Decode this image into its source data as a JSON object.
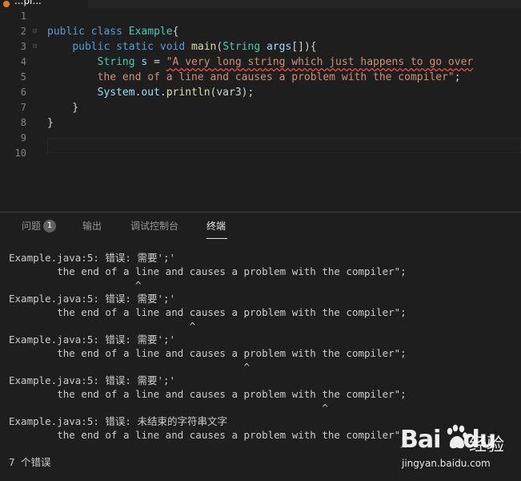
{
  "tab": {
    "label": "...pl..."
  },
  "editor": {
    "lines": [
      {
        "n": "1",
        "tokens": []
      },
      {
        "n": "2",
        "tokens": [
          {
            "t": "public",
            "c": "kw"
          },
          {
            "t": " ",
            "c": "pl"
          },
          {
            "t": "class",
            "c": "kw"
          },
          {
            "t": " ",
            "c": "pl"
          },
          {
            "t": "Example",
            "c": "ty"
          },
          {
            "t": "{",
            "c": "pl"
          }
        ]
      },
      {
        "n": "3",
        "tokens": [
          {
            "t": "    ",
            "c": "pl"
          },
          {
            "t": "public",
            "c": "kw"
          },
          {
            "t": " ",
            "c": "pl"
          },
          {
            "t": "static",
            "c": "kw"
          },
          {
            "t": " ",
            "c": "pl"
          },
          {
            "t": "void",
            "c": "kw"
          },
          {
            "t": " ",
            "c": "pl"
          },
          {
            "t": "main",
            "c": "fn"
          },
          {
            "t": "(",
            "c": "pl"
          },
          {
            "t": "String",
            "c": "ty"
          },
          {
            "t": " ",
            "c": "pl"
          },
          {
            "t": "args",
            "c": "var"
          },
          {
            "t": "[]){",
            "c": "pl"
          }
        ]
      },
      {
        "n": "4",
        "tokens": [
          {
            "t": "        ",
            "c": "pl"
          },
          {
            "t": "String",
            "c": "ty"
          },
          {
            "t": " ",
            "c": "pl"
          },
          {
            "t": "s",
            "c": "var"
          },
          {
            "t": " = ",
            "c": "pl"
          },
          {
            "t": "\"A very long string which just happens to go over",
            "c": "str squiggle"
          }
        ]
      },
      {
        "n": "5",
        "tokens": [
          {
            "t": "        ",
            "c": "pl"
          },
          {
            "t": "the end of a line and causes a problem with the compiler\"",
            "c": "str"
          },
          {
            "t": ";",
            "c": "pl"
          }
        ]
      },
      {
        "n": "6",
        "tokens": [
          {
            "t": "        ",
            "c": "pl"
          },
          {
            "t": "System",
            "c": "var"
          },
          {
            "t": ".",
            "c": "pl"
          },
          {
            "t": "out",
            "c": "var"
          },
          {
            "t": ".",
            "c": "pl"
          },
          {
            "t": "println",
            "c": "fn"
          },
          {
            "t": "(var3);",
            "c": "pl"
          }
        ]
      },
      {
        "n": "7",
        "tokens": [
          {
            "t": "    }",
            "c": "pl"
          }
        ]
      },
      {
        "n": "8",
        "tokens": [
          {
            "t": "}",
            "c": "pl"
          }
        ]
      },
      {
        "n": "9",
        "tokens": []
      },
      {
        "n": "10",
        "tokens": []
      }
    ]
  },
  "panel": {
    "tabs": [
      {
        "label": "问题",
        "badge": "1"
      },
      {
        "label": "输出"
      },
      {
        "label": "调试控制台"
      },
      {
        "label": "终端"
      }
    ]
  },
  "terminal": {
    "lines": [
      "Example.java:5: 错误: 需要';'",
      "        the end of a line and causes a problem with the compiler\";",
      "                     ^",
      "Example.java:5: 错误: 需要';'",
      "        the end of a line and causes a problem with the compiler\";",
      "                              ^",
      "Example.java:5: 错误: 需要';'",
      "        the end of a line and causes a problem with the compiler\";",
      "                                       ^",
      "Example.java:5: 错误: 需要';'",
      "        the end of a line and causes a problem with the compiler\";",
      "                                                    ^",
      "Example.java:5: 错误: 未结束的字符串文字",
      "        the end of a line and causes a problem with the compiler\";",
      "                                                                 ^",
      "7 个错误"
    ]
  },
  "watermark": {
    "logo": "Bai",
    "logo2": "du",
    "cn": "经验",
    "url": "jingyan.baidu.com"
  }
}
